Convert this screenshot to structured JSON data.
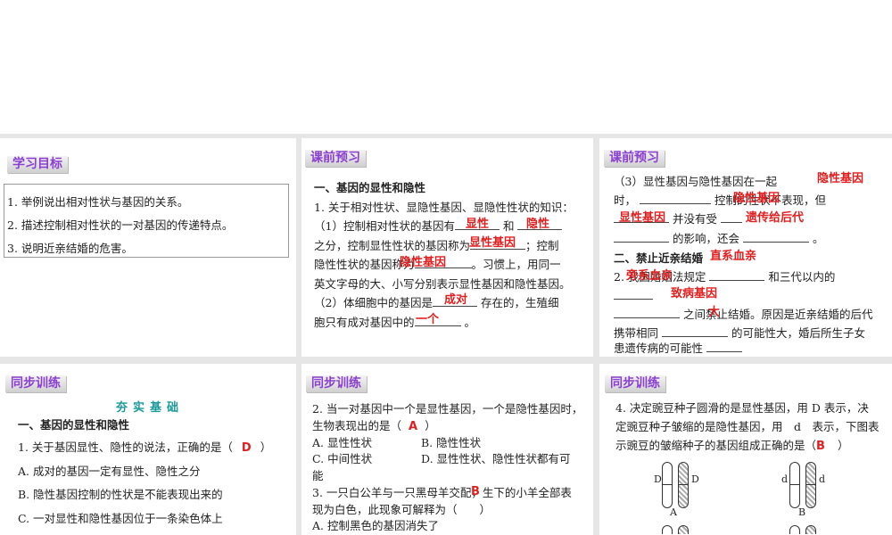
{
  "p1": {
    "tag": "学习目标",
    "goals": [
      "1. 举例说出相对性状与基因的关系。",
      "2. 描述控制相对性状的一对基因的传递特点。",
      "3. 说明近亲结婚的危害。"
    ]
  },
  "p2": {
    "tag": "课前预习",
    "heading": "一、基因的显性和隐性",
    "l1": "1. 关于相对性状、显隐性基因、显隐性性状的知识：",
    "l2a": "（1）控制相对性状的基因有",
    "l2b": "和",
    "l3a": "之分，控制显性性状的基因称为",
    "l3b": "；控制",
    "l4a": "隐性性状的基因称为",
    "l4b": "。习惯上，用同一",
    "l5": "英文字母的大、小写分别表示显性基因和隐性基因。",
    "l6a": "（2）体细胞中的基因是",
    "l6b": "存在的，生殖细",
    "l7a": "胞只有成对基因中的",
    "l7b": "。",
    "answers": [
      "显性",
      "隐性",
      "显性基因",
      "隐性基因",
      "成对",
      "一个"
    ]
  },
  "p3": {
    "tag": "课前预习",
    "l1": "（3）显性基因与隐性基因在一起",
    "l2a": "时，",
    "l2b": "控制的性状不表现，但",
    "l3": "并没有受",
    "l4a": "的影响，还会",
    "l4b": "。",
    "heading": "二、禁止近亲结婚",
    "l5a": "2. 我国婚姻法规定",
    "l5b": "和三代以内的",
    "l7": "之间禁止结婚。原因是近亲结婚的后代",
    "l8a": "携带相同",
    "l8b": "的可能性大，婚后所生子女",
    "l9": "患遗传病的可能性",
    "answers": [
      "隐性基因",
      "隐性基因",
      "显性基因",
      "遗传给后代",
      "直系血亲",
      "旁系血亲",
      "致病基因",
      "大"
    ]
  },
  "p4": {
    "tag": "同步训练",
    "section": "夯实基础",
    "heading": "一、基因的显性和隐性",
    "q1": "1. 关于基因显性、隐性的说法，正确的是（",
    "q1end": "）",
    "answer": "D",
    "options": [
      "A. 成对的基因一定有显性、隐性之分",
      "B. 隐性基因控制的性状是不能表现出来的",
      "C. 一对显性和隐性基因位于一条染色体上"
    ]
  },
  "p5": {
    "tag": "同步训练",
    "q2a": "2. 当一对基因中一个是显性基因，一个是隐性基因时，",
    "q2b": "生物表现出的是（",
    "q2end": "）",
    "q2ans": "A",
    "optA": "A. 显性性状",
    "optB": "B. 隐性性状",
    "optC": "C. 中间性状",
    "optD": "D. 显性性状、隐性性状都有可",
    "optD2": "能",
    "q3a": "3. 一只白公羊与一只黑母羊交配，生下的小羊全部表",
    "q3b": "现为白色，此现象可解释为（　　）",
    "q3ans": "B",
    "q3optA": "A. 控制黑色的基因消失了"
  },
  "p6": {
    "tag": "同步训练",
    "l1": "4. 决定豌豆种子圆滑的是显性基因，用 D 表示，决",
    "l2": "定豌豆种子皱缩的是隐性基因，用　d　表示，下图表",
    "l3": "示豌豆的皱缩种子的基因组成正确的是（",
    "l3end": "）",
    "answer": "B",
    "figA": {
      "label": "A",
      "left": "D",
      "right": "D"
    },
    "figB": {
      "label": "B",
      "left": "d",
      "right": "d"
    }
  }
}
